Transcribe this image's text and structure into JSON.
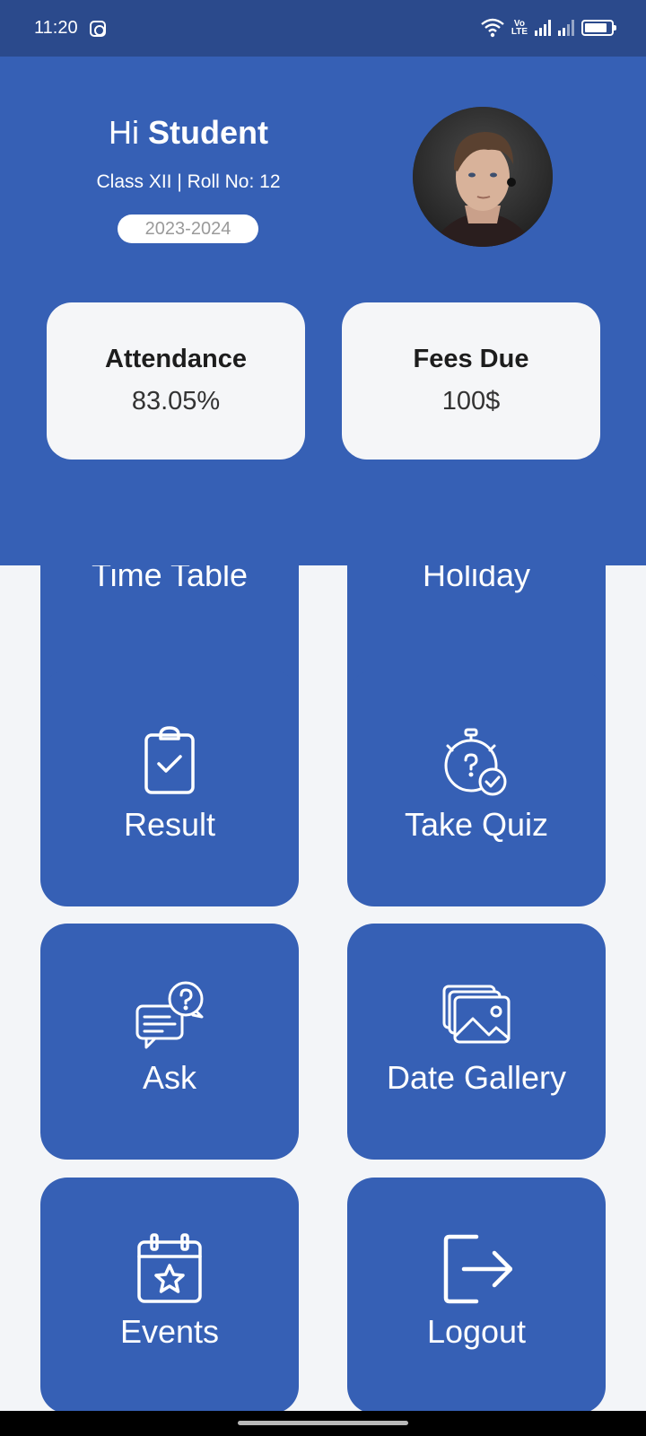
{
  "status_bar": {
    "time": "11:20",
    "volte_top": "Vo",
    "volte_bottom": "LTE",
    "icons": [
      "instagram-icon",
      "wifi-icon",
      "volte-icon",
      "signal-icon",
      "signal-icon",
      "battery-icon"
    ]
  },
  "profile": {
    "greeting_hi": "Hi",
    "greeting_name": "Student",
    "class_info": "Class XII | Roll No: 12",
    "session": "2023-2024"
  },
  "stats": {
    "attendance_label": "Attendance",
    "attendance_value": "83.05%",
    "fees_label": "Fees Due",
    "fees_value": "100$"
  },
  "menu": {
    "time_table": "Time Table",
    "holiday": "Holiday",
    "result": "Result",
    "take_quiz": "Take Quiz",
    "ask": "Ask",
    "date_gallery": "Date Gallery",
    "events": "Events",
    "logout": "Logout"
  },
  "colors": {
    "primary": "#3660b5",
    "status_bar": "#2b4a8c",
    "background": "#f3f5f8",
    "card": "#f5f6f8"
  }
}
